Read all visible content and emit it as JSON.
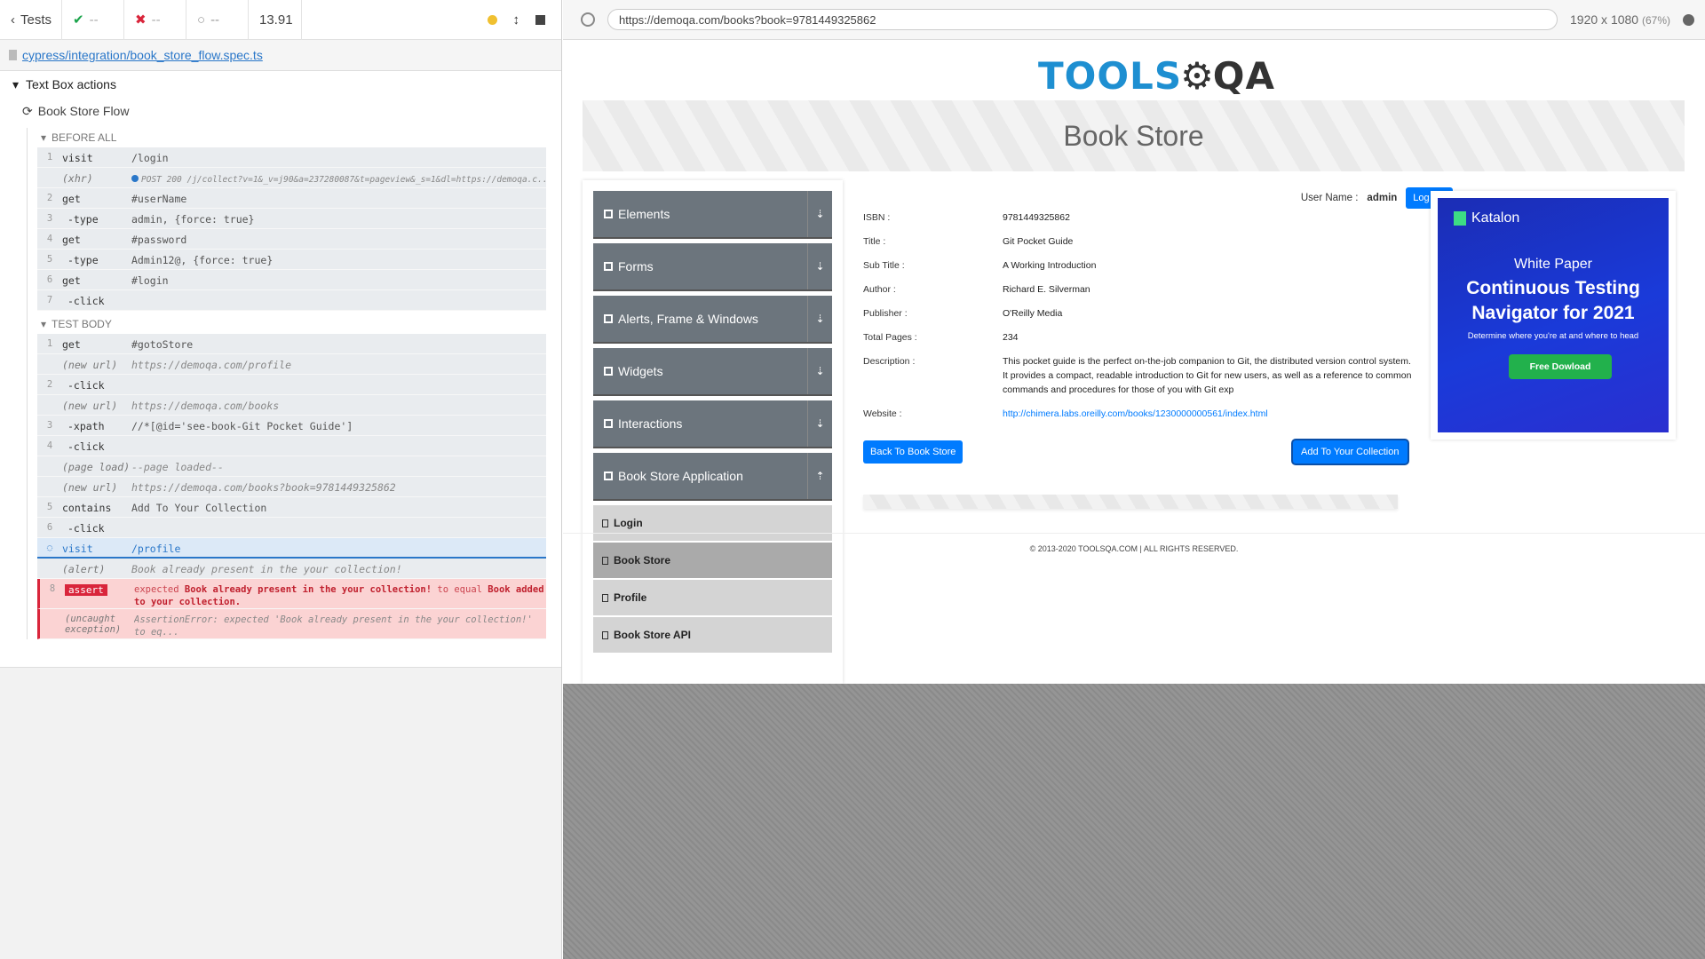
{
  "topbar": {
    "back_label": "Tests",
    "passed": "--",
    "failed": "--",
    "pending": "--",
    "duration": "13.91"
  },
  "spec": {
    "path": "cypress/integration/book_store_flow.spec.ts"
  },
  "runner": {
    "suite": "Text Box actions",
    "test": "Book Store Flow",
    "before_all_label": "BEFORE ALL",
    "test_body_label": "TEST BODY",
    "before_all": [
      {
        "num": "1",
        "name": "visit",
        "msg": "/login"
      },
      {
        "num": "",
        "name": "(xhr)",
        "msg": "POST 200 /j/collect?v=1&_v=j90&a=237280087&t=pageview&_s=1&dl=https://demoqa.c..."
      },
      {
        "num": "2",
        "name": "get",
        "msg": "#userName"
      },
      {
        "num": "3",
        "name": "-type",
        "msg": "admin, {force: true}"
      },
      {
        "num": "4",
        "name": "get",
        "msg": "#password"
      },
      {
        "num": "5",
        "name": "-type",
        "msg": "Admin12@, {force: true}"
      },
      {
        "num": "6",
        "name": "get",
        "msg": "#login"
      },
      {
        "num": "7",
        "name": "-click",
        "msg": ""
      }
    ],
    "test_body": [
      {
        "num": "1",
        "name": "get",
        "msg": "#gotoStore"
      },
      {
        "num": "",
        "name": "(new url)",
        "msg": "https://demoqa.com/profile"
      },
      {
        "num": "2",
        "name": "-click",
        "msg": ""
      },
      {
        "num": "",
        "name": "(new url)",
        "msg": "https://demoqa.com/books"
      },
      {
        "num": "3",
        "name": "-xpath",
        "msg": "//*[@id='see-book-Git Pocket Guide']"
      },
      {
        "num": "4",
        "name": "-click",
        "msg": ""
      },
      {
        "num": "",
        "name": "(page load)",
        "msg": "--page loaded--"
      },
      {
        "num": "",
        "name": "(new url)",
        "msg": "https://demoqa.com/books?book=9781449325862"
      },
      {
        "num": "5",
        "name": "contains",
        "msg": "Add To Your Collection"
      },
      {
        "num": "6",
        "name": "-click",
        "msg": ""
      },
      {
        "num": "",
        "name": "visit",
        "msg": "/profile"
      },
      {
        "num": "",
        "name": "(alert)",
        "msg": "Book already present in the your collection!"
      }
    ],
    "assert": {
      "num": "8",
      "name": "assert",
      "msg_1": "expected",
      "msg_2": "Book already present in the your collection!",
      "msg_3": "to equal",
      "msg_4": "Book added to your collection."
    },
    "uncaught": {
      "name": "(uncaught exception)",
      "msg": "AssertionError: expected 'Book already present in the your collection!' to eq..."
    }
  },
  "browser": {
    "url": "https://demoqa.com/books?book=9781449325862",
    "viewport": "1920 x 1080",
    "zoom": "(67%)"
  },
  "app": {
    "logo_tools": "TOOLS",
    "logo_qa": "QA",
    "page_title": "Book Store",
    "user_label": "User Name :",
    "user_name": "admin",
    "logout": "Log out",
    "groups": [
      {
        "label": "Elements"
      },
      {
        "label": "Forms"
      },
      {
        "label": "Alerts, Frame & Windows"
      },
      {
        "label": "Widgets"
      },
      {
        "label": "Interactions"
      },
      {
        "label": "Book Store Application"
      }
    ],
    "menu_items": [
      "Login",
      "Book Store",
      "Profile",
      "Book Store API"
    ],
    "book": {
      "isbn_label": "ISBN :",
      "isbn": "9781449325862",
      "title_label": "Title :",
      "title": "Git Pocket Guide",
      "subtitle_label": "Sub Title :",
      "subtitle": "A Working Introduction",
      "author_label": "Author :",
      "author": "Richard E. Silverman",
      "publisher_label": "Publisher :",
      "publisher": "O'Reilly Media",
      "pages_label": "Total Pages :",
      "pages": "234",
      "desc_label": "Description :",
      "desc": "This pocket guide is the perfect on-the-job companion to Git, the distributed version control system. It provides a compact, readable introduction to Git for new users, as well as a reference to common commands and procedures for those of you with Git exp",
      "website_label": "Website :",
      "website": "http://chimera.labs.oreilly.com/books/1230000000561/index.html"
    },
    "back_button": "Back To Book Store",
    "add_button": "Add To Your Collection",
    "footer": "© 2013-2020 TOOLSQA.COM | ALL RIGHTS RESERVED."
  },
  "ad": {
    "brand": "Katalon",
    "kicker": "White Paper",
    "title": "Continuous Testing Navigator for 2021",
    "sub": "Determine where you're at and where to head",
    "cta": "Free Dowload"
  }
}
